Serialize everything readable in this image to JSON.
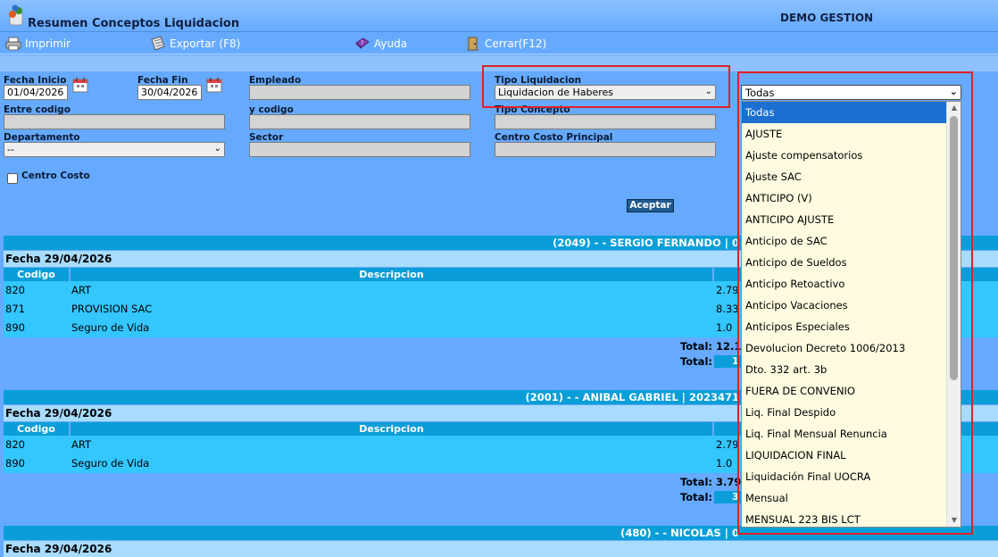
{
  "header": {
    "title": "Resumen Conceptos Liquidacion",
    "company": "DEMO GESTION"
  },
  "toolbar": {
    "print": "Imprimir",
    "export": "Exportar (F8)",
    "help": "Ayuda",
    "close": "Cerrar(F12)"
  },
  "filters": {
    "fecha_inicio_label": "Fecha Inicio",
    "fecha_inicio_value": "01/04/2026",
    "fecha_fin_label": "Fecha Fin",
    "fecha_fin_value": "30/04/2026",
    "empleado_label": "Empleado",
    "empleado_value": "",
    "tipo_liquidacion_label": "Tipo Liquidacion",
    "tipo_liquidacion_value": "Liquidacion de Haberes",
    "entre_codigo_label": "Entre codigo",
    "y_codigo_label": "y codigo",
    "tipo_concepto_label": "Tipo Concepto",
    "departamento_label": "Departamento",
    "departamento_value": "--",
    "sector_label": "Sector",
    "centro_costo_principal_label": "Centro Costo Principal",
    "centro_costo_label": "Centro Costo",
    "aceptar": "Aceptar"
  },
  "dropdown": {
    "selected": "Todas",
    "options": [
      "Todas",
      "AJUSTE",
      "Ajuste compensatorios",
      "Ajuste SAC",
      "ANTICIPO (V)",
      "ANTICIPO AJUSTE",
      "Anticipo de SAC",
      "Anticipo de Sueldos",
      "Anticipo Retoactivo",
      "Anticipo Vacaciones",
      "Anticipos Especiales",
      "Devolucion Decreto 1006/2013",
      "Dto. 332 art. 3b",
      "FUERA DE CONVENIO",
      "Liq. Final Despido",
      "Liq. Final Mensual Renuncia",
      "LIQUIDACION FINAL",
      "Liquidación Final UOCRA",
      "Mensual",
      "MENSUAL 223 BIS LCT"
    ]
  },
  "results": {
    "col_codigo": "Codigo",
    "col_descripcion": "Descripcion",
    "total_label": "Total:",
    "groups": [
      {
        "header": "(2049) - - SERGIO FERNANDO | 0",
        "date": "Fecha 29/04/2026",
        "rows": [
          {
            "codigo": "820",
            "descripcion": "ART",
            "valor": "2.79"
          },
          {
            "codigo": "871",
            "descripcion": "PROVISION SAC",
            "valor": "8.33"
          },
          {
            "codigo": "890",
            "descripcion": "Seguro de Vida",
            "valor": "1.0"
          }
        ],
        "total1": "12.1",
        "total2": "1"
      },
      {
        "header": "(2001) - - ANIBAL GABRIEL | 2023471",
        "date": "Fecha 29/04/2026",
        "rows": [
          {
            "codigo": "820",
            "descripcion": "ART",
            "valor": "2.79"
          },
          {
            "codigo": "890",
            "descripcion": "Seguro de Vida",
            "valor": "1.0"
          }
        ],
        "total1": "3.79",
        "total2": "3"
      },
      {
        "header": "(480) - - NICOLAS | 0",
        "date": "Fecha 29/04/2026"
      }
    ]
  }
}
